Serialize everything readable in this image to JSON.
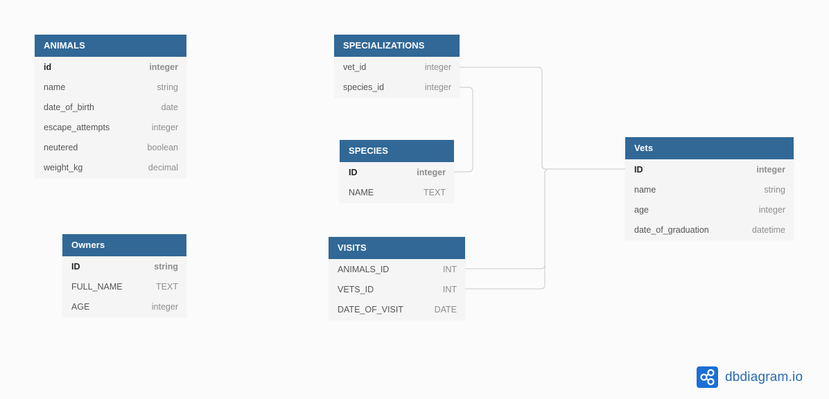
{
  "tables": {
    "animals": {
      "name": "ANIMALS",
      "columns": [
        {
          "name": "id",
          "type": "integer",
          "pk": true
        },
        {
          "name": "name",
          "type": "string"
        },
        {
          "name": "date_of_birth",
          "type": "date"
        },
        {
          "name": "escape_attempts",
          "type": "integer"
        },
        {
          "name": "neutered",
          "type": "boolean"
        },
        {
          "name": "weight_kg",
          "type": "decimal"
        }
      ]
    },
    "specializations": {
      "name": "SPECIALIZATIONS",
      "columns": [
        {
          "name": "vet_id",
          "type": "integer"
        },
        {
          "name": "species_id",
          "type": "integer"
        }
      ]
    },
    "species": {
      "name": "SPECIES",
      "columns": [
        {
          "name": "ID",
          "type": "integer",
          "pk": true
        },
        {
          "name": "NAME",
          "type": "TEXT"
        }
      ]
    },
    "vets": {
      "name": "Vets",
      "columns": [
        {
          "name": "ID",
          "type": "integer",
          "pk": true
        },
        {
          "name": "name",
          "type": "string"
        },
        {
          "name": "age",
          "type": "integer"
        },
        {
          "name": "date_of_graduation",
          "type": "datetime"
        }
      ]
    },
    "owners": {
      "name": "Owners",
      "columns": [
        {
          "name": "ID",
          "type": "string",
          "pk": true
        },
        {
          "name": "FULL_NAME",
          "type": "TEXT"
        },
        {
          "name": "AGE",
          "type": "integer"
        }
      ]
    },
    "visits": {
      "name": "VISITS",
      "columns": [
        {
          "name": "ANIMALS_ID",
          "type": "INT"
        },
        {
          "name": "VETS_ID",
          "type": "INT"
        },
        {
          "name": "DATE_OF_VISIT",
          "type": "DATE"
        }
      ]
    }
  },
  "brand": {
    "name": "dbdiagram.io",
    "icon": "share-nodes-icon",
    "color": "#1b6fd6"
  },
  "colors": {
    "header": "#316896",
    "row_bg": "#f5f5f5",
    "connector": "#c9c9c9"
  }
}
